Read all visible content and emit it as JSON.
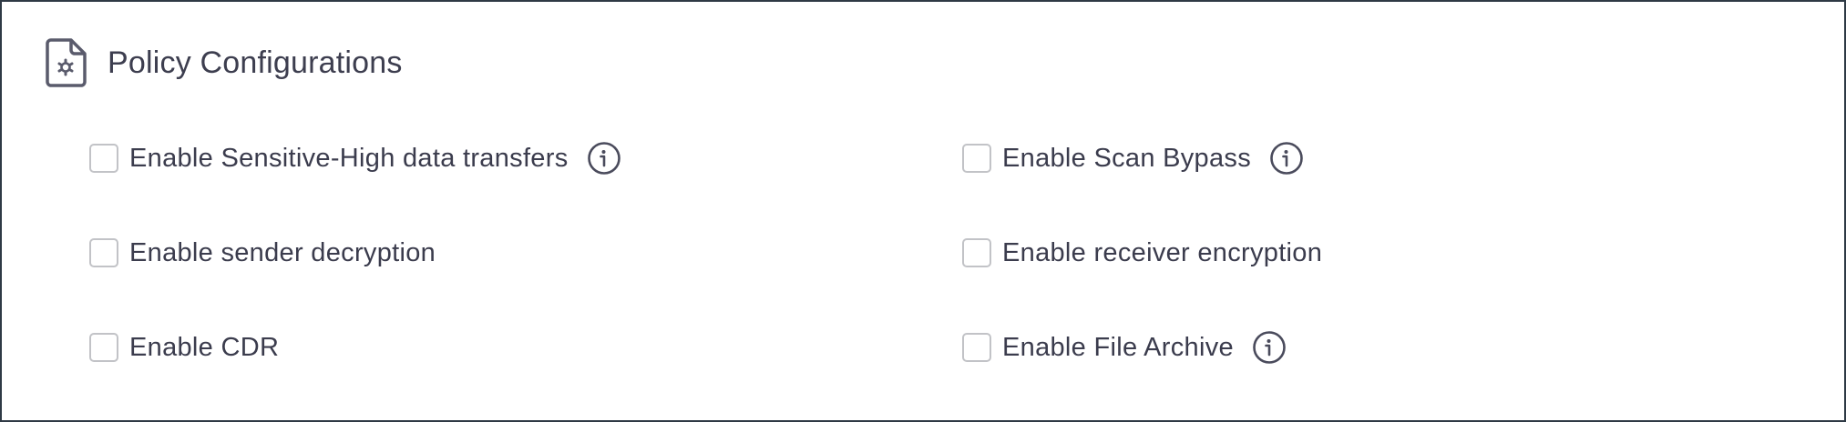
{
  "section": {
    "title": "Policy Configurations",
    "icon": "file-settings-icon"
  },
  "options": {
    "sensitive_high": {
      "label": "Enable Sensitive-High data transfers",
      "checked": false,
      "has_info": true
    },
    "scan_bypass": {
      "label": "Enable Scan Bypass",
      "checked": false,
      "has_info": true
    },
    "sender_decryption": {
      "label": "Enable sender decryption",
      "checked": false,
      "has_info": false
    },
    "receiver_encryption": {
      "label": "Enable receiver encryption",
      "checked": false,
      "has_info": false
    },
    "cdr": {
      "label": "Enable CDR",
      "checked": false,
      "has_info": false
    },
    "file_archive": {
      "label": "Enable File Archive",
      "checked": false,
      "has_info": true
    }
  },
  "colors": {
    "border": "#2f3a45",
    "text": "#3b3c4d",
    "checkbox_border": "#c2c3c7",
    "icon": "#4a4b5c"
  }
}
